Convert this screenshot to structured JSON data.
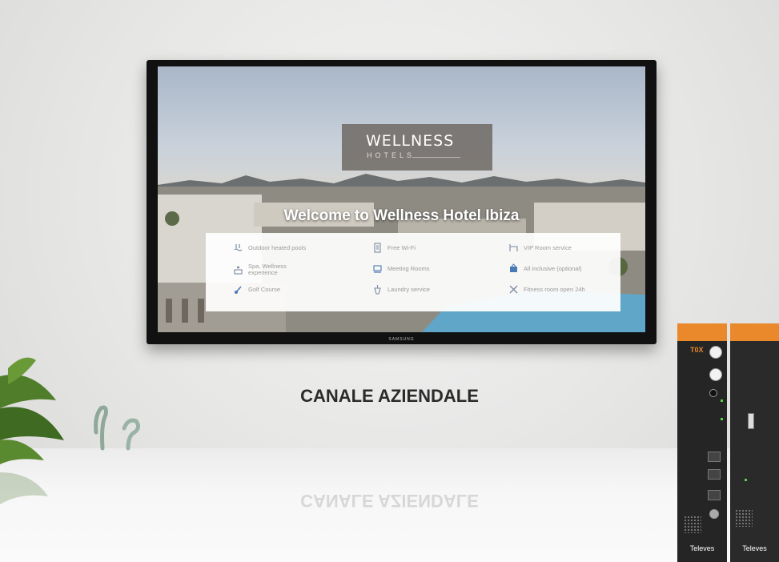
{
  "tv": {
    "logo_main": "WELLNESS",
    "logo_sub": "HOTELS",
    "welcome": "Welcome to Wellness Hotel Ibiza",
    "brand": "SAMSUNG",
    "amenities": [
      {
        "icon": "pool-icon",
        "label": "Outdoor heated pools"
      },
      {
        "icon": "wifi-icon",
        "label": "Free Wi-Fi"
      },
      {
        "icon": "room-service-icon",
        "label": "VIP Room service"
      },
      {
        "icon": "spa-icon",
        "label": "Spa, Wellness experience"
      },
      {
        "icon": "meeting-icon",
        "label": "Meeting Rooms"
      },
      {
        "icon": "all-inclusive-icon",
        "label": "All inclusive (optional)"
      },
      {
        "icon": "golf-icon",
        "label": "Golf Course"
      },
      {
        "icon": "laundry-icon",
        "label": "Laundry service"
      },
      {
        "icon": "fitness-icon",
        "label": "Fitness room open 24h"
      }
    ]
  },
  "heading": "CANALE AZIENDALE",
  "device": {
    "module1_logo": "T0X",
    "module1_brand": "Televes",
    "module2_brand": "Televes"
  },
  "colors": {
    "accent_orange": "#e9892b",
    "heading": "#2b2b2b"
  }
}
